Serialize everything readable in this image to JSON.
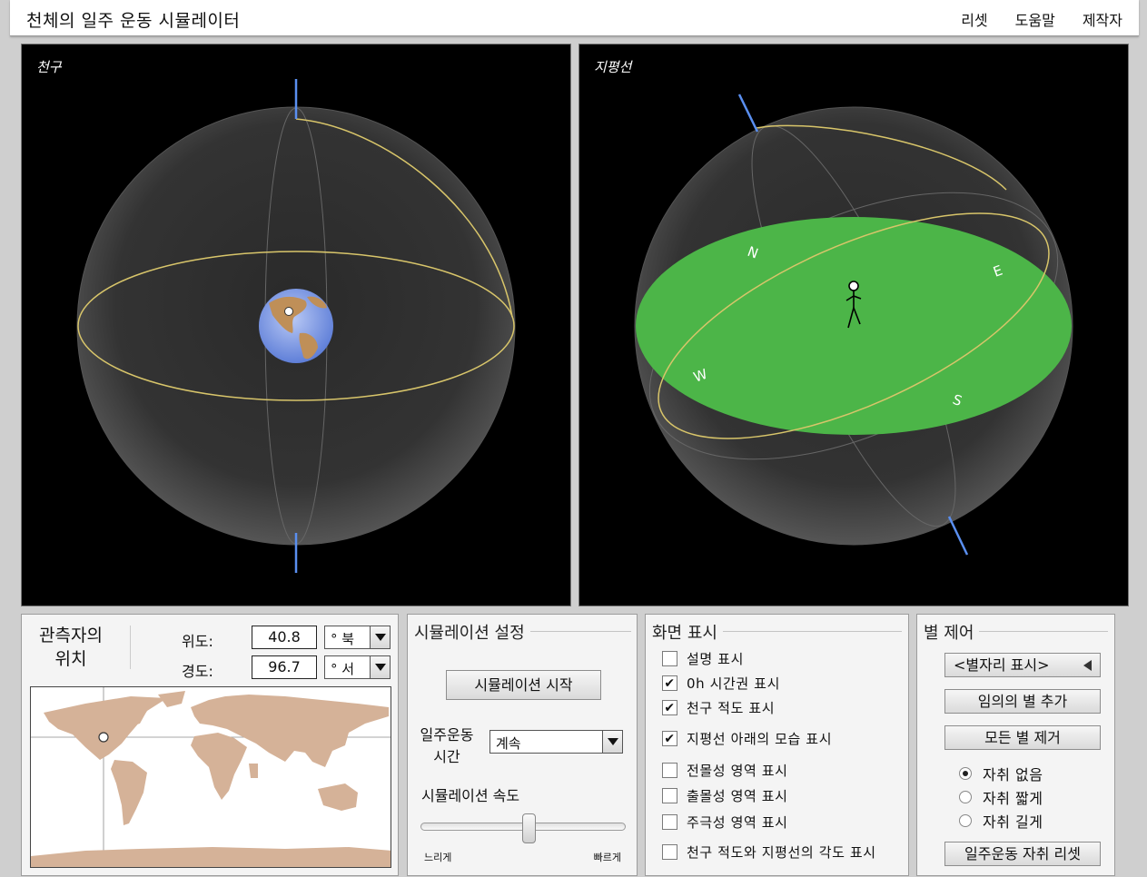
{
  "app": {
    "title": "천체의 일주 운동 시뮬레이터",
    "menu": [
      "리셋",
      "도움말",
      "제작자"
    ]
  },
  "views": {
    "celestial_label": "천구",
    "horizon_label": "지평선",
    "directions": {
      "N": "N",
      "E": "E",
      "S": "S",
      "W": "W"
    }
  },
  "observer": {
    "title_line1": "관측자의",
    "title_line2": "위치",
    "latitude_label": "위도:",
    "latitude_value": "40.8",
    "latitude_unit": "° 북",
    "longitude_label": "경도:",
    "longitude_value": "96.7",
    "longitude_unit": "° 서"
  },
  "simulation": {
    "title": "시뮬레이션 설정",
    "start_button": "시뮬레이션 시작",
    "duration_label_line1": "일주운동",
    "duration_label_line2": "시간",
    "duration_value": "계속",
    "speed_label": "시뮬레이션 속도",
    "speed_slow": "느리게",
    "speed_fast": "빠르게",
    "speed_fraction": 0.53
  },
  "display": {
    "title": "화면 표시",
    "options": [
      {
        "label": "설명 표시",
        "checked": false
      },
      {
        "label": "0h 시간권 표시",
        "checked": true
      },
      {
        "label": "천구 적도 표시",
        "checked": true
      },
      {
        "label": "지평선 아래의 모습 표시",
        "checked": true
      },
      {
        "label": "전몰성 영역 표시",
        "checked": false
      },
      {
        "label": "출몰성 영역 표시",
        "checked": false
      },
      {
        "label": "주극성 영역 표시",
        "checked": false
      },
      {
        "label": "천구 적도와 지평선의 각도 표시",
        "checked": false
      }
    ]
  },
  "stars": {
    "title": "별 제어",
    "constellation_button": "<별자리 표시>",
    "add_button": "임의의 별 추가",
    "remove_button": "모든 별 제거",
    "trail_options": [
      {
        "label": "자취 없음",
        "selected": true
      },
      {
        "label": "자취 짧게",
        "selected": false
      },
      {
        "label": "자취 길게",
        "selected": false
      }
    ],
    "reset_button": "일주운동 자취 리셋"
  },
  "colors": {
    "horizon_plane": "#4cb548",
    "equator_line": "#d8c56a",
    "axis_line": "#5a8ff0",
    "map_ocean": "#ffffff",
    "map_land": "#d5b298"
  },
  "icons": [
    "chevron-down-icon",
    "checkmark-icon",
    "triangle-left-icon",
    "observer-stick-figure-icon"
  ]
}
